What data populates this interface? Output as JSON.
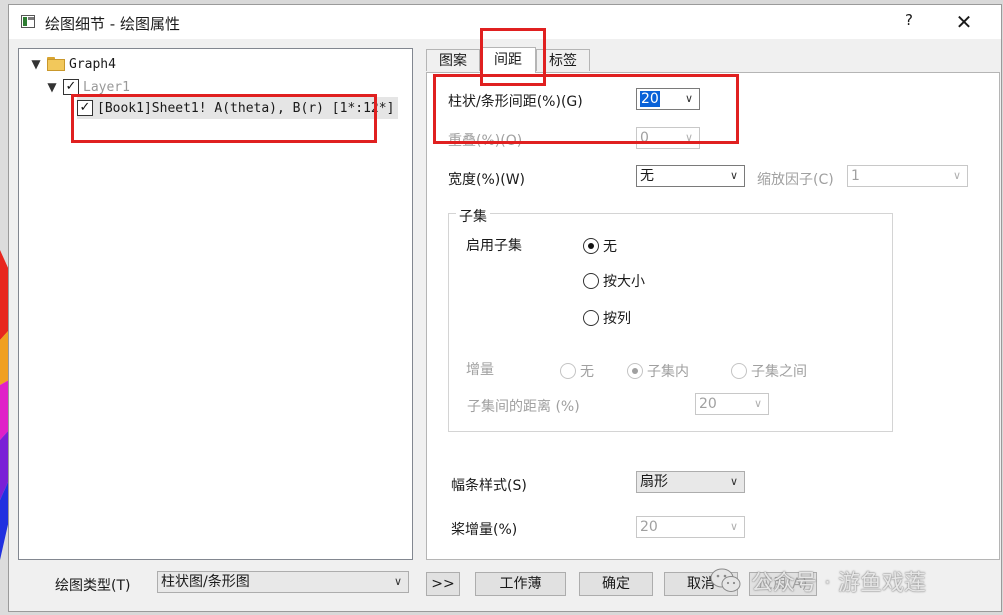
{
  "window": {
    "title": "绘图细节 - 绘图属性",
    "help": "?",
    "close": "✕"
  },
  "tree": {
    "root": "Graph4",
    "layer": "Layer1",
    "plot": "[Book1]Sheet1! A(theta), B(r) [1*:12*]"
  },
  "tabs": [
    {
      "label": "图案"
    },
    {
      "label": "间距"
    },
    {
      "label": "标签"
    }
  ],
  "spacing": {
    "label": "柱状/条形间距(%)(G)",
    "value": "20"
  },
  "overlap": {
    "label": "重叠(%)(O)",
    "value": "0"
  },
  "width": {
    "label": "宽度(%)(W)",
    "value": "无",
    "scale_label": "缩放因子(C)",
    "scale_value": "1"
  },
  "subset": {
    "title": "子集",
    "enable_label": "启用子集",
    "options": [
      "无",
      "按大小",
      "按列"
    ],
    "increment_label": "增量",
    "increment_options": [
      "无",
      "子集内",
      "子集之间"
    ],
    "distance_label": "子集间的距离 (%)",
    "distance_value": "20"
  },
  "strip": {
    "label": "幅条样式(S)",
    "value": "扇形"
  },
  "paddle": {
    "label": "桨增量(%)",
    "value": "20"
  },
  "footer": {
    "plot_type_label": "绘图类型(T)",
    "plot_type_value": "柱状图/条形图",
    "expand": ">>",
    "workbook": "工作薄",
    "ok": "确定",
    "cancel": "取消",
    "apply": "应用(A)"
  },
  "watermark": "公众号 · 游鱼戏莲",
  "colors": {
    "highlight": "#e02020",
    "selection": "#0a62d8"
  }
}
